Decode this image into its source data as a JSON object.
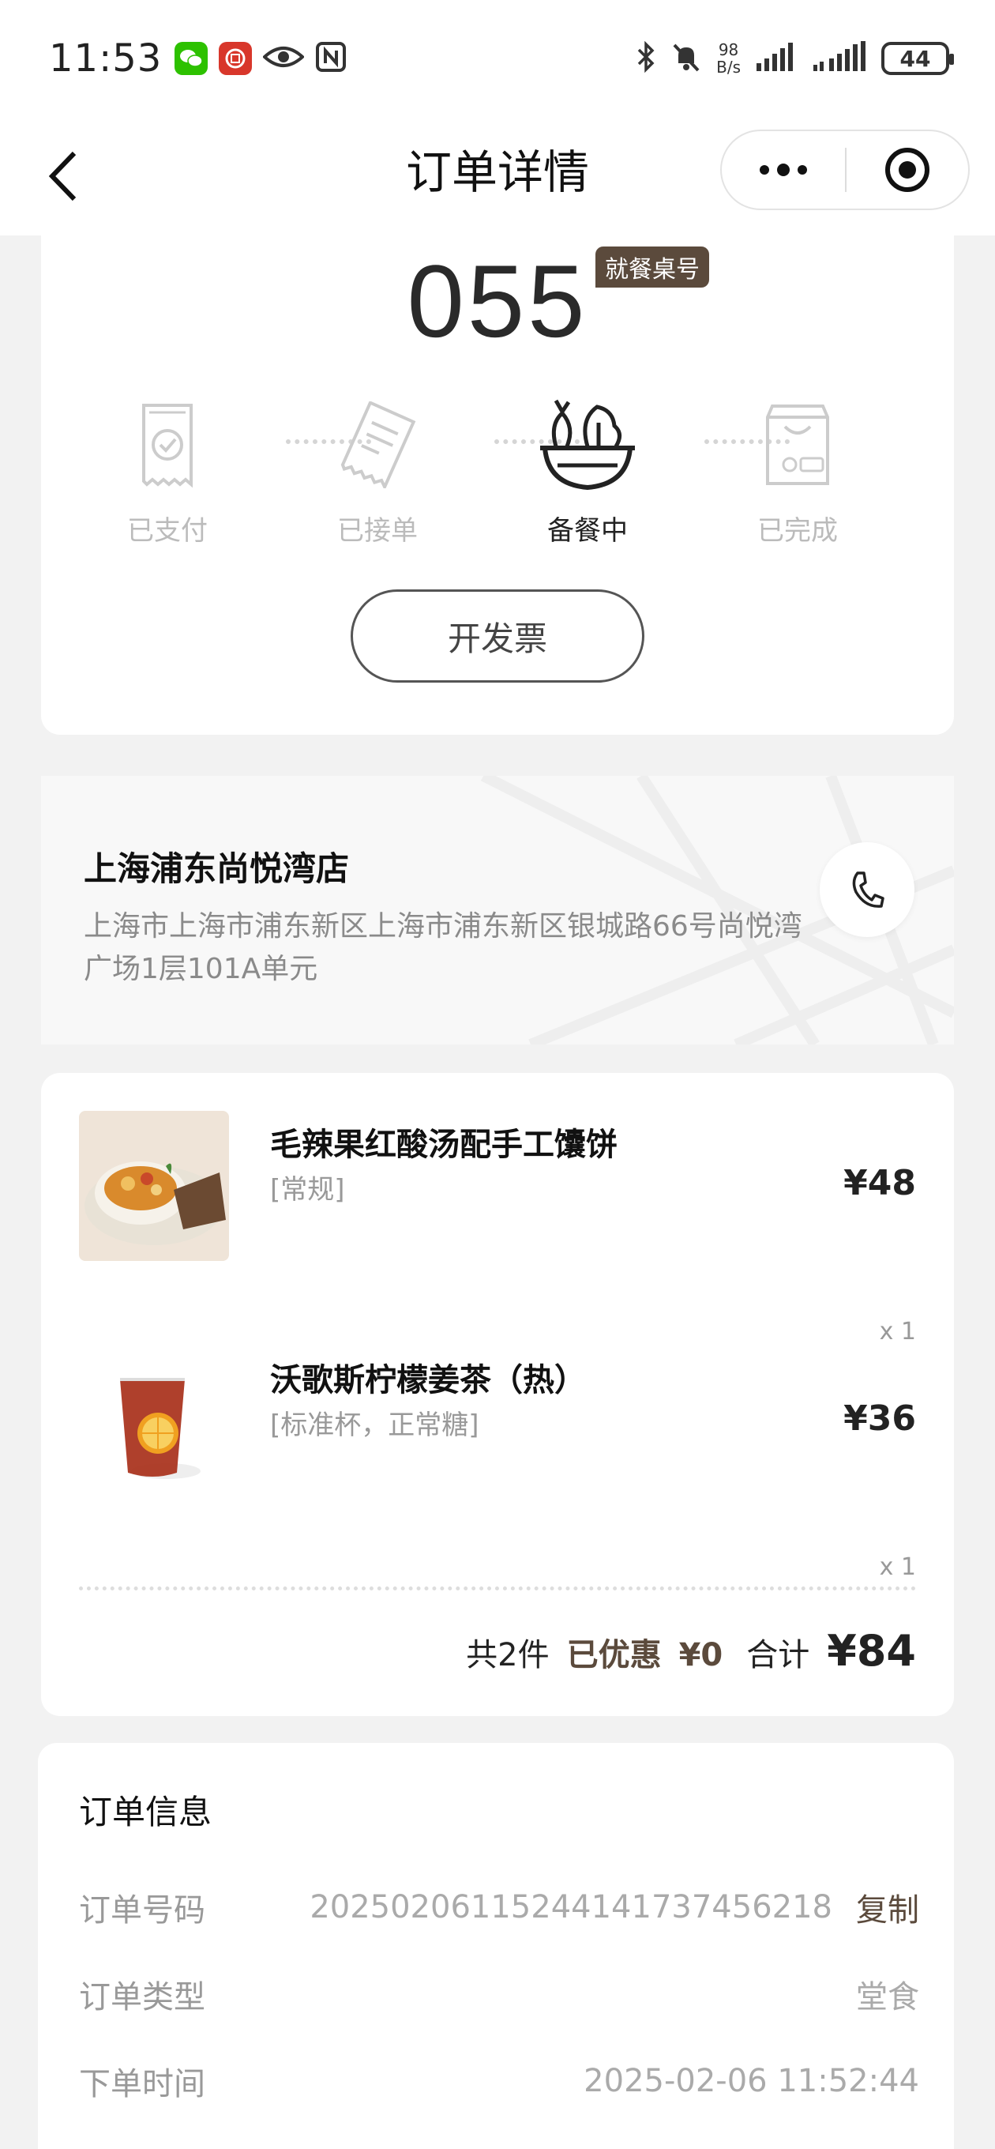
{
  "status_bar": {
    "time": "11:53",
    "net_speed_top": "98",
    "net_speed_bottom": "B/s",
    "battery": "44"
  },
  "nav": {
    "title": "订单详情"
  },
  "order_status": {
    "table_number": "055",
    "table_badge": "就餐桌号",
    "steps": [
      {
        "label": "已支付",
        "active": false
      },
      {
        "label": "已接单",
        "active": false
      },
      {
        "label": "备餐中",
        "active": true
      },
      {
        "label": "已完成",
        "active": false
      }
    ],
    "invoice_button": "开发票"
  },
  "store": {
    "name": "上海浦东尚悦湾店",
    "address": "上海市上海市浦东新区上海市浦东新区银城路66号尚悦湾广场1层101A单元"
  },
  "items": [
    {
      "name": "毛辣果红酸汤配手工馕饼",
      "spec": "[常规]",
      "price": "¥48",
      "qty": "x 1"
    },
    {
      "name": "沃歌斯柠檬姜茶（热）",
      "spec": "[标准杯，正常糖]",
      "price": "¥36",
      "qty": "x 1"
    }
  ],
  "totals": {
    "count": "共2件",
    "discount_label": "已优惠",
    "discount_value": "¥0",
    "sum_label": "合计",
    "sum_value": "¥84"
  },
  "order_info": {
    "title": "订单信息",
    "order_no_label": "订单号码",
    "order_no": "20250206115244141737456218",
    "copy": "复制",
    "type_label": "订单类型",
    "type": "堂食",
    "time_label": "下单时间",
    "time": "2025-02-06 11:52:44"
  },
  "colors": {
    "accent": "#5b4a3c",
    "muted": "#999999"
  }
}
